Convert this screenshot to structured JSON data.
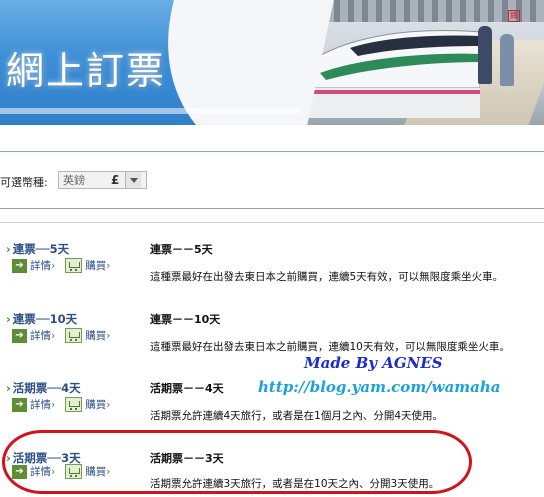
{
  "banner": {
    "title": "網上訂票"
  },
  "currency": {
    "label": "可選幣種:",
    "selected_name": "英鎊",
    "selected_symbol": "£"
  },
  "tickets": [
    {
      "name": "連票──5天",
      "detail_label": "詳情",
      "buy_label": "購買",
      "title": "連票－－5天",
      "description": "這種票最好在出發去東日本之前購買，連續5天有效，可以無限度乘坐火車。"
    },
    {
      "name": "連票──10天",
      "detail_label": "詳情",
      "buy_label": "購買",
      "title": "連票－－10天",
      "description": "這種票最好在出發去東日本之前購買，連續10天有效，可以無限度乘坐火車。"
    },
    {
      "name": "活期票──4天",
      "detail_label": "詳情",
      "buy_label": "購買",
      "title": "活期票－－4天",
      "description": "活期票允許連續4天旅行，或者是在1個月之內、分開4天使用。"
    },
    {
      "name": "活期票──3天",
      "detail_label": "詳情",
      "buy_label": "購買",
      "title": "活期票－－3天",
      "description": "活期票允許連續3天旅行，或者是在10天之內、分開3天使用。"
    }
  ],
  "watermark": {
    "line1": "Made By AGNES",
    "line2": "http://blog.yam.com/wamaha"
  },
  "colors": {
    "link": "#2b4d87",
    "accent_green": "#5d8d34",
    "highlight_red": "#d0141a",
    "banner_blue": "#3e8fd6"
  }
}
